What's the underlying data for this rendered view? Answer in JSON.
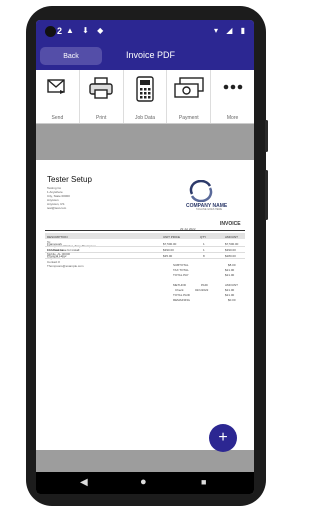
{
  "status": {
    "time": "2",
    "icons_left": "▲ ⬇ ◆",
    "icons_right": "▾ ◢ ▮"
  },
  "appbar": {
    "back_label": "Back",
    "title": "Invoice PDF"
  },
  "toolbar": {
    "items": [
      {
        "label": "Send",
        "icon": "envelope-icon"
      },
      {
        "label": "Print",
        "icon": "printer-icon"
      },
      {
        "label": "Job Data",
        "icon": "calculator-icon"
      },
      {
        "label": "Payment",
        "icon": "banknotes-icon"
      },
      {
        "label": "More",
        "icon": "more-dots-icon"
      }
    ]
  },
  "doc": {
    "title": "Tester Setup",
    "from_lines": [
      "Testing Co",
      "1 Anywhere",
      "City, State 00000",
      "Anytown",
      "Anytown, US",
      "test@test.com"
    ],
    "logo_name": "COMPANY NAME",
    "logo_tagline": "TAGLINE GOES HERE",
    "date": "29 Jul 2022",
    "invoice_label": "INVOICE",
    "billto_lines": [
      "To:",
      "Thompsons Painter, Tony Thompson",
      "172 Madison",
      "Mobile, AL 00000",
      "Anywhere, AL",
      "Contact #",
      "Thompsons@example.com"
    ],
    "table": {
      "headers": [
        "DESCRIPTION",
        "UNIT PRICE",
        "QTY",
        "AMOUNT"
      ],
      "rows": [
        [
          "Framework",
          "$7,500.00",
          "1",
          "$7,500.00"
        ],
        [
          "Concrete base for install",
          "$390.00",
          "1",
          "$390.00"
        ],
        [
          "Physical Labor",
          "$35.00",
          "8",
          "$280.00"
        ]
      ]
    },
    "subtotal_label": "SUBTOTAL",
    "subtotal": "$8.00",
    "tax_label": "TAX TOTAL",
    "tax": "$21.00",
    "total_label": "TOTAL PAY",
    "total": "$21.00",
    "payments": {
      "headers": [
        "METHOD",
        "PAID",
        "AMOUNT"
      ],
      "row": [
        "Check",
        "02/1/2022",
        "$21.00"
      ],
      "total_paid_label": "TOTAL PAID",
      "total_paid": "$21.00",
      "remaining_label": "REMAINING",
      "remaining": "$0.00"
    }
  },
  "fab_label": "+",
  "nav": {
    "back": "◀",
    "home": "●",
    "recent": "■"
  },
  "colors": {
    "primary": "#2c2792",
    "back_button": "#544ea8"
  }
}
